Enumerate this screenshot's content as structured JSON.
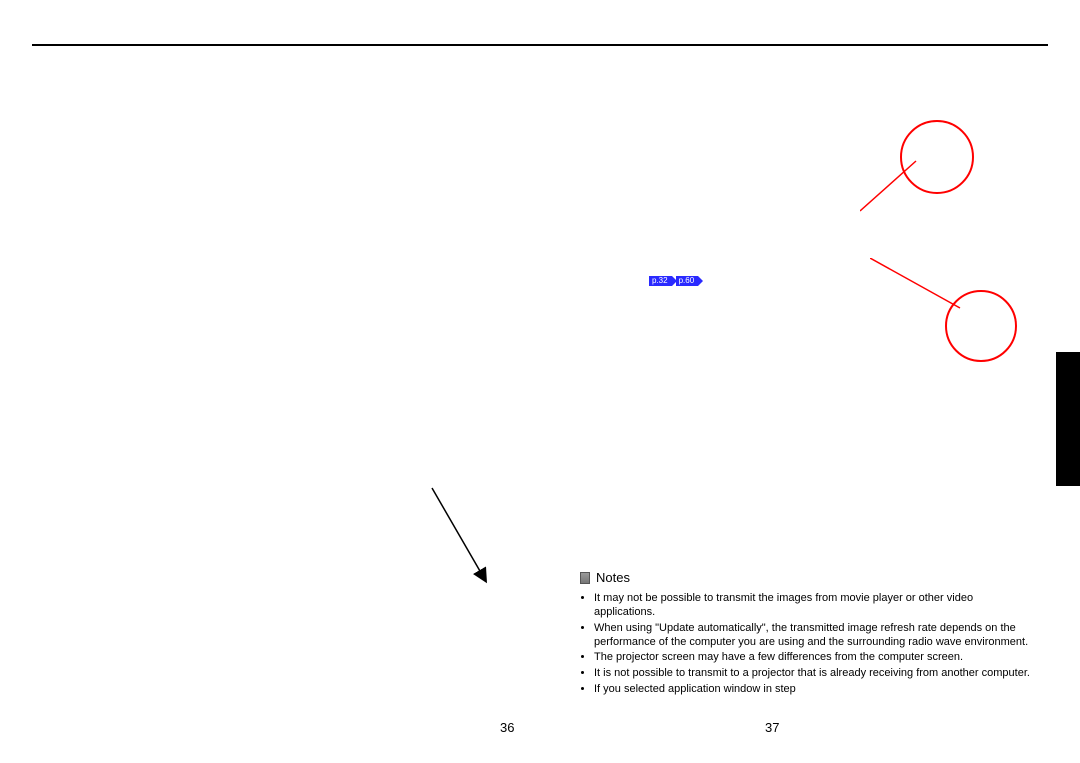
{
  "page_numbers": {
    "left": "36",
    "right": "37"
  },
  "page_refs": [
    {
      "label": "p.32"
    },
    {
      "label": "p.60"
    }
  ],
  "notes": {
    "heading": "Notes",
    "items": [
      "It may not be possible to transmit the images from movie player or other video applications.",
      "When using \"Update automatically\", the transmitted image refresh rate depends on the performance of the computer you are using and the surrounding radio wave environment.",
      "The projector screen may have a few differences from the computer screen.",
      "It is not possible to transmit to a projector that is already receiving from another computer.",
      "If you selected application window in step"
    ]
  }
}
